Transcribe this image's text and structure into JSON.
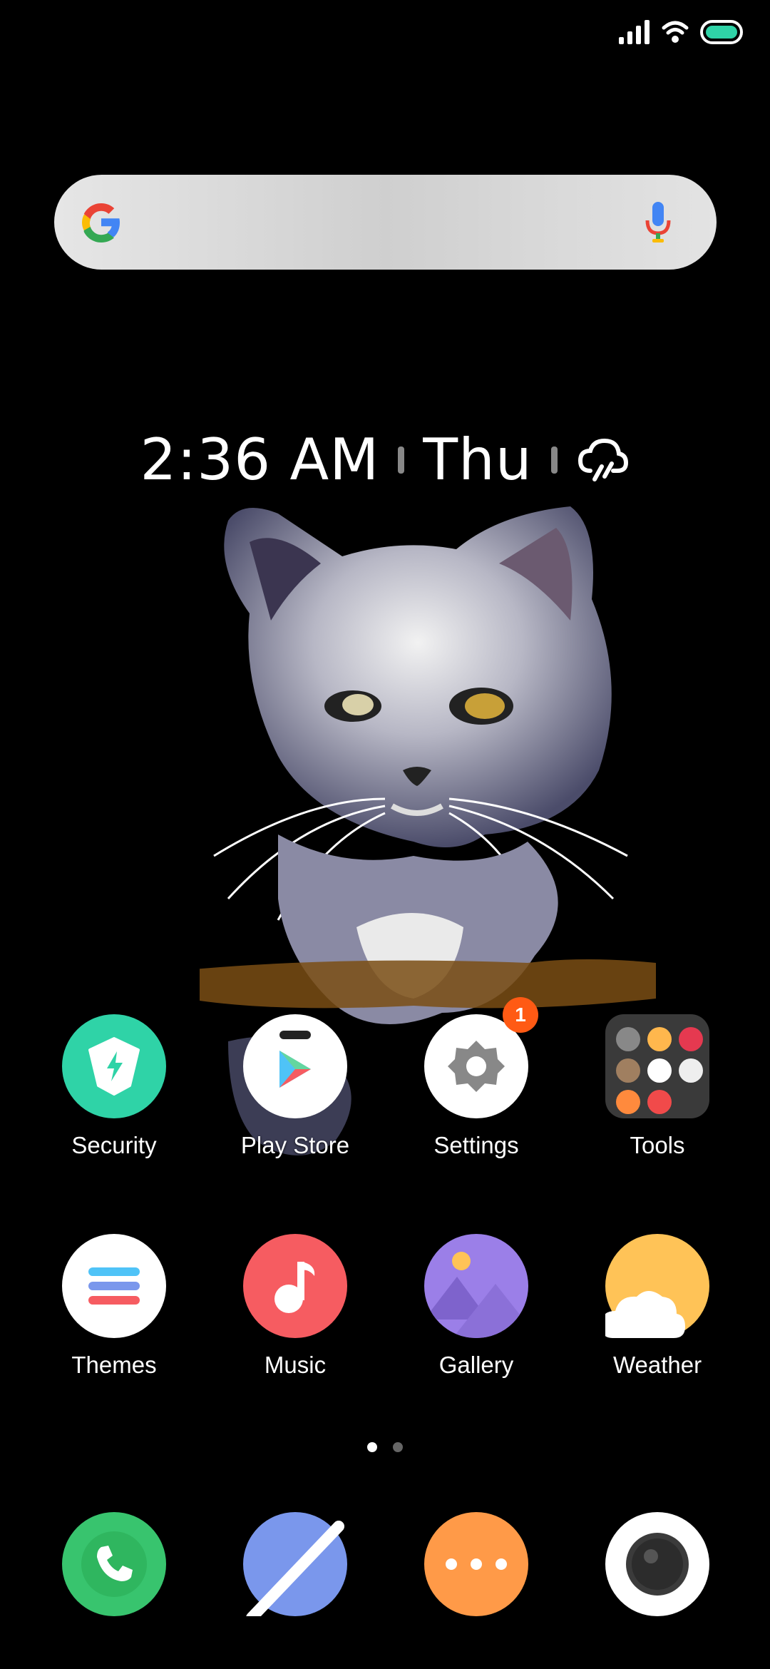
{
  "clock": {
    "time": "2:36 AM",
    "day": "Thu"
  },
  "apps_row1": [
    {
      "label": "Security"
    },
    {
      "label": "Play Store"
    },
    {
      "label": "Settings",
      "badge": "1"
    },
    {
      "label": "Tools"
    }
  ],
  "apps_row2": [
    {
      "label": "Themes"
    },
    {
      "label": "Music"
    },
    {
      "label": "Gallery"
    },
    {
      "label": "Weather"
    }
  ],
  "dock": [
    {
      "icon": "phone-icon"
    },
    {
      "icon": "browser-icon"
    },
    {
      "icon": "messaging-icon"
    },
    {
      "icon": "camera-icon"
    }
  ],
  "page_indicator": {
    "pages": 2,
    "current": 1
  },
  "colors": {
    "security": "#2fd3a7",
    "music": "#f65c61",
    "gallery": "#9b7fe8",
    "weather_sun": "#ffc357",
    "phone": "#38c46e",
    "browser": "#7a97ec",
    "messaging": "#ff9a48",
    "badge": "#ff5a14"
  }
}
